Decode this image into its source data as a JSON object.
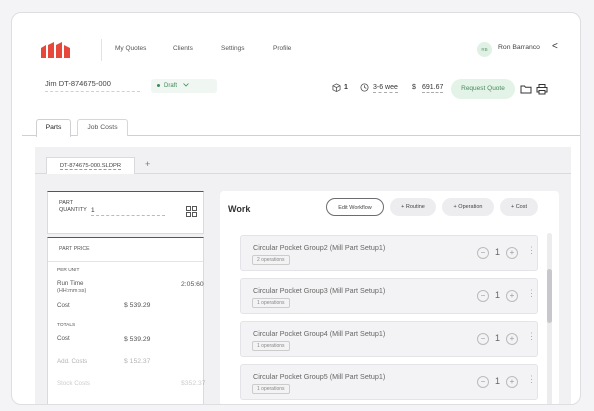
{
  "nav": {
    "links": [
      "My Quotes",
      "Clients",
      "Settings",
      "Profile"
    ],
    "user_initials": "RB",
    "user_name": "Ron Barranco",
    "collapse_glyph": "<"
  },
  "job": {
    "id": "Jim DT-874675-000",
    "status": "Draft",
    "parts_count": "1",
    "lead_time": "3-6 wee",
    "price_symbol": "$",
    "price": "691.67",
    "request_quote": "Request Quote"
  },
  "tabs": [
    "Parts",
    "Job Costs"
  ],
  "file_tab": "DT-874675-000.SLDPR",
  "add_tab": "+",
  "quantity": {
    "label_line1": "PART",
    "label_line2": "QUANTITY",
    "value": "1"
  },
  "part_price": {
    "title": "PART PRICE",
    "per_unit": "PER UNIT",
    "run_time_label": "Run Time",
    "run_time_unit": "(HH:mm:ss)",
    "run_time_value": "2:05:60",
    "cost_label": "Cost",
    "cost_value": "$  539.29",
    "totals": "TOTALS",
    "total_cost_label": "Cost",
    "total_cost_value": "$  539.29",
    "addl_label": "Add. Costs",
    "addl_value": "$  152.37",
    "stock_label": "Stock Costs",
    "stock_value": "$352.37"
  },
  "work": {
    "title": "Work",
    "edit_workflow": "Edit Workflow",
    "routine": "+ Routine",
    "operation": "+ Operation",
    "cost": "+ Cost",
    "operations": [
      {
        "name": "Circular Pocket Group2 (Mill Part Setup1)",
        "badge": "2 operations",
        "qty": "1"
      },
      {
        "name": "Circular Pocket Group3 (Mill Part Setup1)",
        "badge": "1 operations",
        "qty": "1"
      },
      {
        "name": "Circular Pocket Group4 (Mill Part Setup1)",
        "badge": "1 operations",
        "qty": "1"
      },
      {
        "name": "Circular Pocket Group5 (Mill Part Setup1)",
        "badge": "1 operations",
        "qty": "1"
      }
    ]
  },
  "icons": {
    "logo": "brand-logo",
    "parts": "cube-icon",
    "lead_time": "clock-icon",
    "folder": "folder-icon",
    "print": "printer-icon",
    "grid": "grid-icon"
  },
  "colors": {
    "accent_red": "#e8473c",
    "draft_green": "#3f8a55",
    "quote_bg": "#e4f3e8"
  }
}
